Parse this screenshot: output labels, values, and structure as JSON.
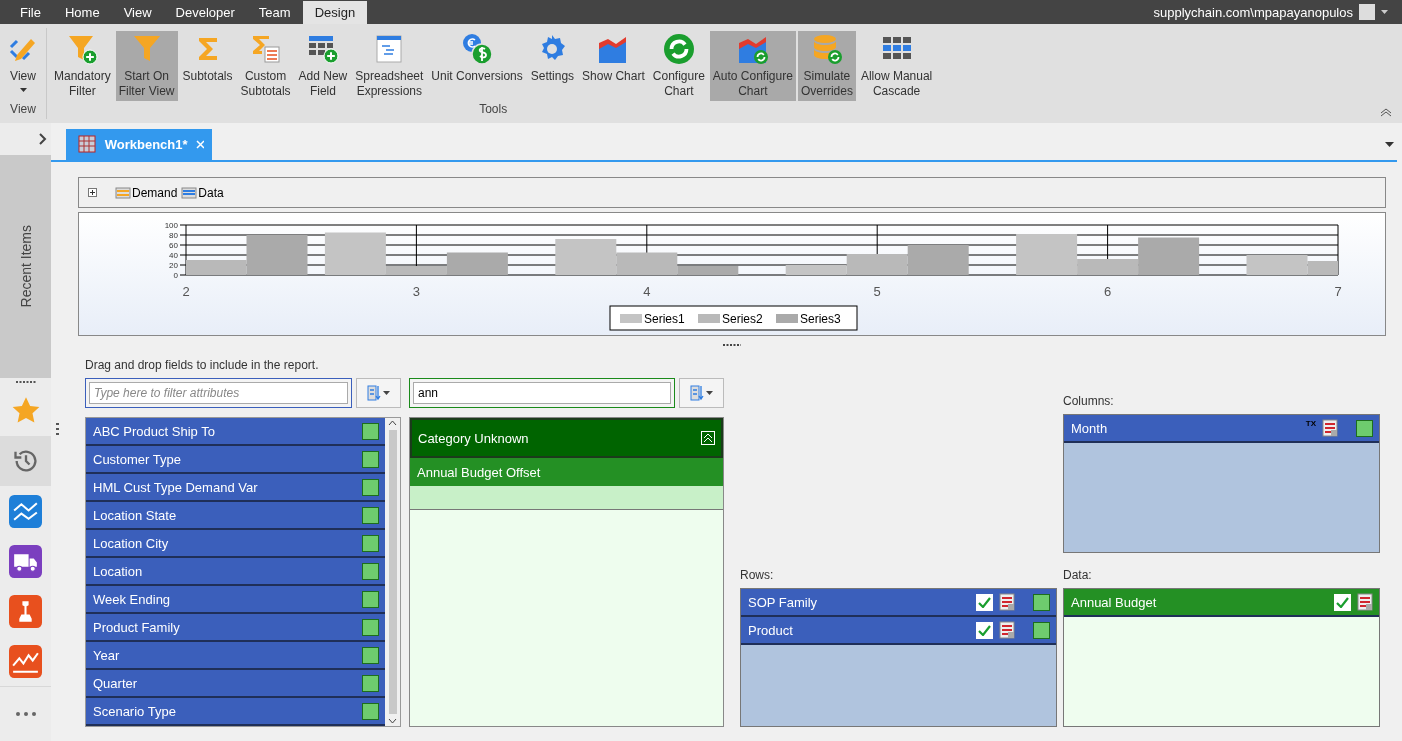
{
  "menu_tabs": [
    {
      "label": "File",
      "selected": false
    },
    {
      "label": "Home",
      "selected": false
    },
    {
      "label": "View",
      "selected": false
    },
    {
      "label": "Developer",
      "selected": false
    },
    {
      "label": "Team",
      "selected": false
    },
    {
      "label": "Design",
      "selected": true
    }
  ],
  "user": "supplychain.com\\mpapayanopulos",
  "ribbon": {
    "groups": [
      {
        "label": "View",
        "buttons": [
          {
            "label": "View",
            "pressed": false,
            "dropdown": true
          }
        ]
      },
      {
        "label": "Tools",
        "buttons": [
          {
            "label": "Mandatory\nFilter",
            "pressed": false
          },
          {
            "label": "Start On\nFilter View",
            "pressed": true
          },
          {
            "label": "Subtotals",
            "pressed": false
          },
          {
            "label": "Custom\nSubtotals",
            "pressed": false
          },
          {
            "label": "Add New\nField",
            "pressed": false
          },
          {
            "label": "Spreadsheet\nExpressions",
            "pressed": false
          },
          {
            "label": "Unit Conversions",
            "pressed": false
          },
          {
            "label": "Settings",
            "pressed": false
          },
          {
            "label": "Show Chart",
            "pressed": false
          },
          {
            "label": "Configure\nChart",
            "pressed": false
          },
          {
            "label": "Auto Configure\nChart",
            "pressed": true
          },
          {
            "label": "Simulate\nOverrides",
            "pressed": true
          },
          {
            "label": "Allow Manual\nCascade",
            "pressed": false
          }
        ]
      }
    ]
  },
  "sidebar": {
    "title": "Recent Items",
    "items": [
      {
        "selected": false
      },
      {
        "selected": true
      },
      {
        "selected": false
      },
      {
        "selected": false
      },
      {
        "selected": false
      },
      {
        "selected": false
      }
    ]
  },
  "doc_tabs": [
    {
      "label": "Workbench1*",
      "selected": true
    }
  ],
  "breadcrumb": [
    "Demand",
    "Data"
  ],
  "chart_data": {
    "type": "bar",
    "categories": [
      "2",
      "3",
      "4",
      "5",
      "6",
      "7"
    ],
    "yticks": [
      0,
      20,
      40,
      60,
      80,
      100
    ],
    "ylim": [
      0,
      100
    ],
    "grid": true,
    "legend": "bottom",
    "series": [
      {
        "name": "Series1",
        "color": "#c4c4c4",
        "values": [
          null,
          85,
          72,
          20,
          82,
          40
        ]
      },
      {
        "name": "Series2",
        "color": "#b9b9b9",
        "values": [
          30,
          18,
          45,
          42,
          32,
          28
        ]
      },
      {
        "name": "Series3",
        "color": "#aaaaaa",
        "values": [
          80,
          45,
          18,
          60,
          75,
          null
        ]
      }
    ]
  },
  "hint": "Drag and drop fields to include in the report.",
  "attribute_filter": {
    "placeholder": "Type here to filter attributes"
  },
  "attributes": [
    "ABC Product Ship To",
    "Customer Type",
    "HML Cust Type Demand Var",
    "Location State",
    "Location City",
    "Location",
    "Week Ending",
    "Product Family",
    "Year",
    "Quarter",
    "Scenario Type"
  ],
  "category_filter": {
    "value": "ann"
  },
  "category": {
    "title": "Category Unknown",
    "expanded": true,
    "items": [
      "Annual Budget Offset"
    ]
  },
  "columns": {
    "label": "Columns:",
    "fields": [
      {
        "name": "Month",
        "badge": "TX"
      }
    ]
  },
  "rows": {
    "label": "Rows:",
    "fields": [
      {
        "name": "SOP Family",
        "checked": true
      },
      {
        "name": "Product",
        "checked": true
      }
    ]
  },
  "data": {
    "label": "Data:",
    "fields": [
      {
        "name": "Annual Budget",
        "checked": true
      }
    ]
  }
}
